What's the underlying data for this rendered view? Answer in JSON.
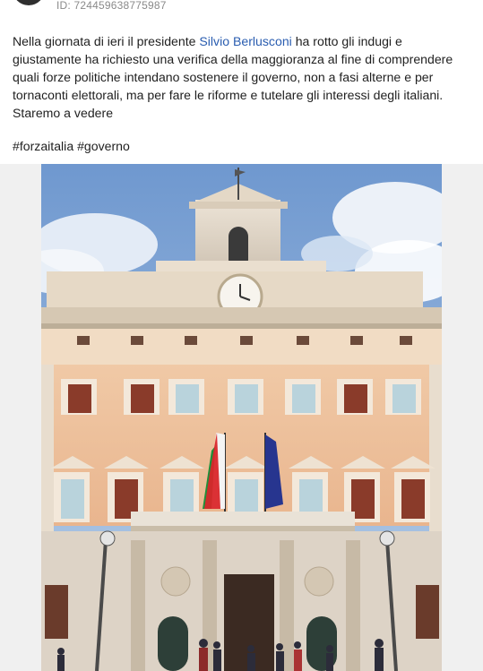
{
  "post": {
    "id_label": "ID: 724459638775987",
    "text_before_mention": "Nella giornata di ieri il presidente ",
    "mention": "Silvio Berlusconi",
    "text_after_mention": " ha rotto gli indugi e giustamente ha richiesto una verifica della maggioranza al fine di comprendere quali forze politiche intendano sostenere il governo, non a fasi alterne e per tornaconti elettorali, ma per fare le riforme e tutelare gli interessi degli italiani. Staremo a vedere",
    "hashtags": "#forzaitalia #governo"
  },
  "colors": {
    "mention": "#2a5db0",
    "feed_background": "#f0f0f0",
    "card_background": "#ffffff"
  },
  "image": {
    "subject": "Palazzo Montecitorio facade with Italian and EU flags"
  }
}
